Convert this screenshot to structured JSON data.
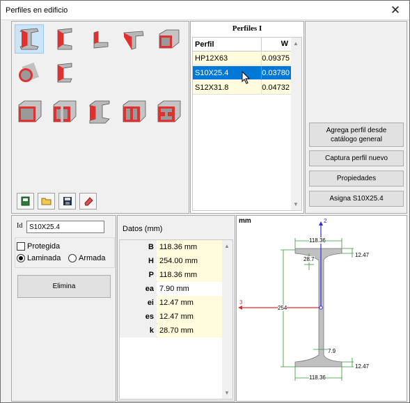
{
  "window": {
    "title": "Perfiles en edificio",
    "close_glyph": "✕"
  },
  "toolbar_icons": [
    "new-icon",
    "open-folder-icon",
    "save-icon",
    "eraser-icon"
  ],
  "profiles_grid": {
    "title": "Perfiles I",
    "columns": [
      "Perfil",
      "W"
    ],
    "rows": [
      {
        "perfil": "HP12X63",
        "w": "0.09375"
      },
      {
        "perfil": "S10X25.4",
        "w": "0.03780"
      },
      {
        "perfil": "S12X31.8",
        "w": "0.04732"
      }
    ],
    "selected_index": 1
  },
  "actions": {
    "add_from_catalog": "Agrega perfil desde catálogo general",
    "capture_new": "Captura perfil nuevo",
    "properties": "Propiedades",
    "assign": "Asigna S10X25.4"
  },
  "left": {
    "id_label": "Id",
    "id_value": "S10X25.4",
    "protegida_label": "Protegida",
    "laminada_label": "Laminada",
    "armada_label": "Armada",
    "elimina_label": "Elimina"
  },
  "datos": {
    "header": "Datos (mm)",
    "rows": [
      {
        "key": "B",
        "value": "118.36 mm"
      },
      {
        "key": "H",
        "value": "254.00 mm"
      },
      {
        "key": "P",
        "value": "118.36 mm"
      },
      {
        "key": "ea",
        "value": "7.90 mm"
      },
      {
        "key": "ei",
        "value": "12.47 mm"
      },
      {
        "key": "es",
        "value": "12.47 mm"
      },
      {
        "key": "k",
        "value": "28.70 mm"
      }
    ]
  },
  "drawing": {
    "unit": "mm",
    "axis2": "2",
    "axis3": "3",
    "dim_top_width": "118.36",
    "dim_k": "28.7",
    "dim_top_flange": "12.47",
    "dim_height": "254",
    "dim_web": "7.9",
    "dim_bottom_flange": "12.47",
    "dim_bottom_width": "118.36"
  },
  "colors": {
    "selection": "#0078d7",
    "highlight_cell": "#fffbdc",
    "profile_fill": "#c0c0c0"
  }
}
